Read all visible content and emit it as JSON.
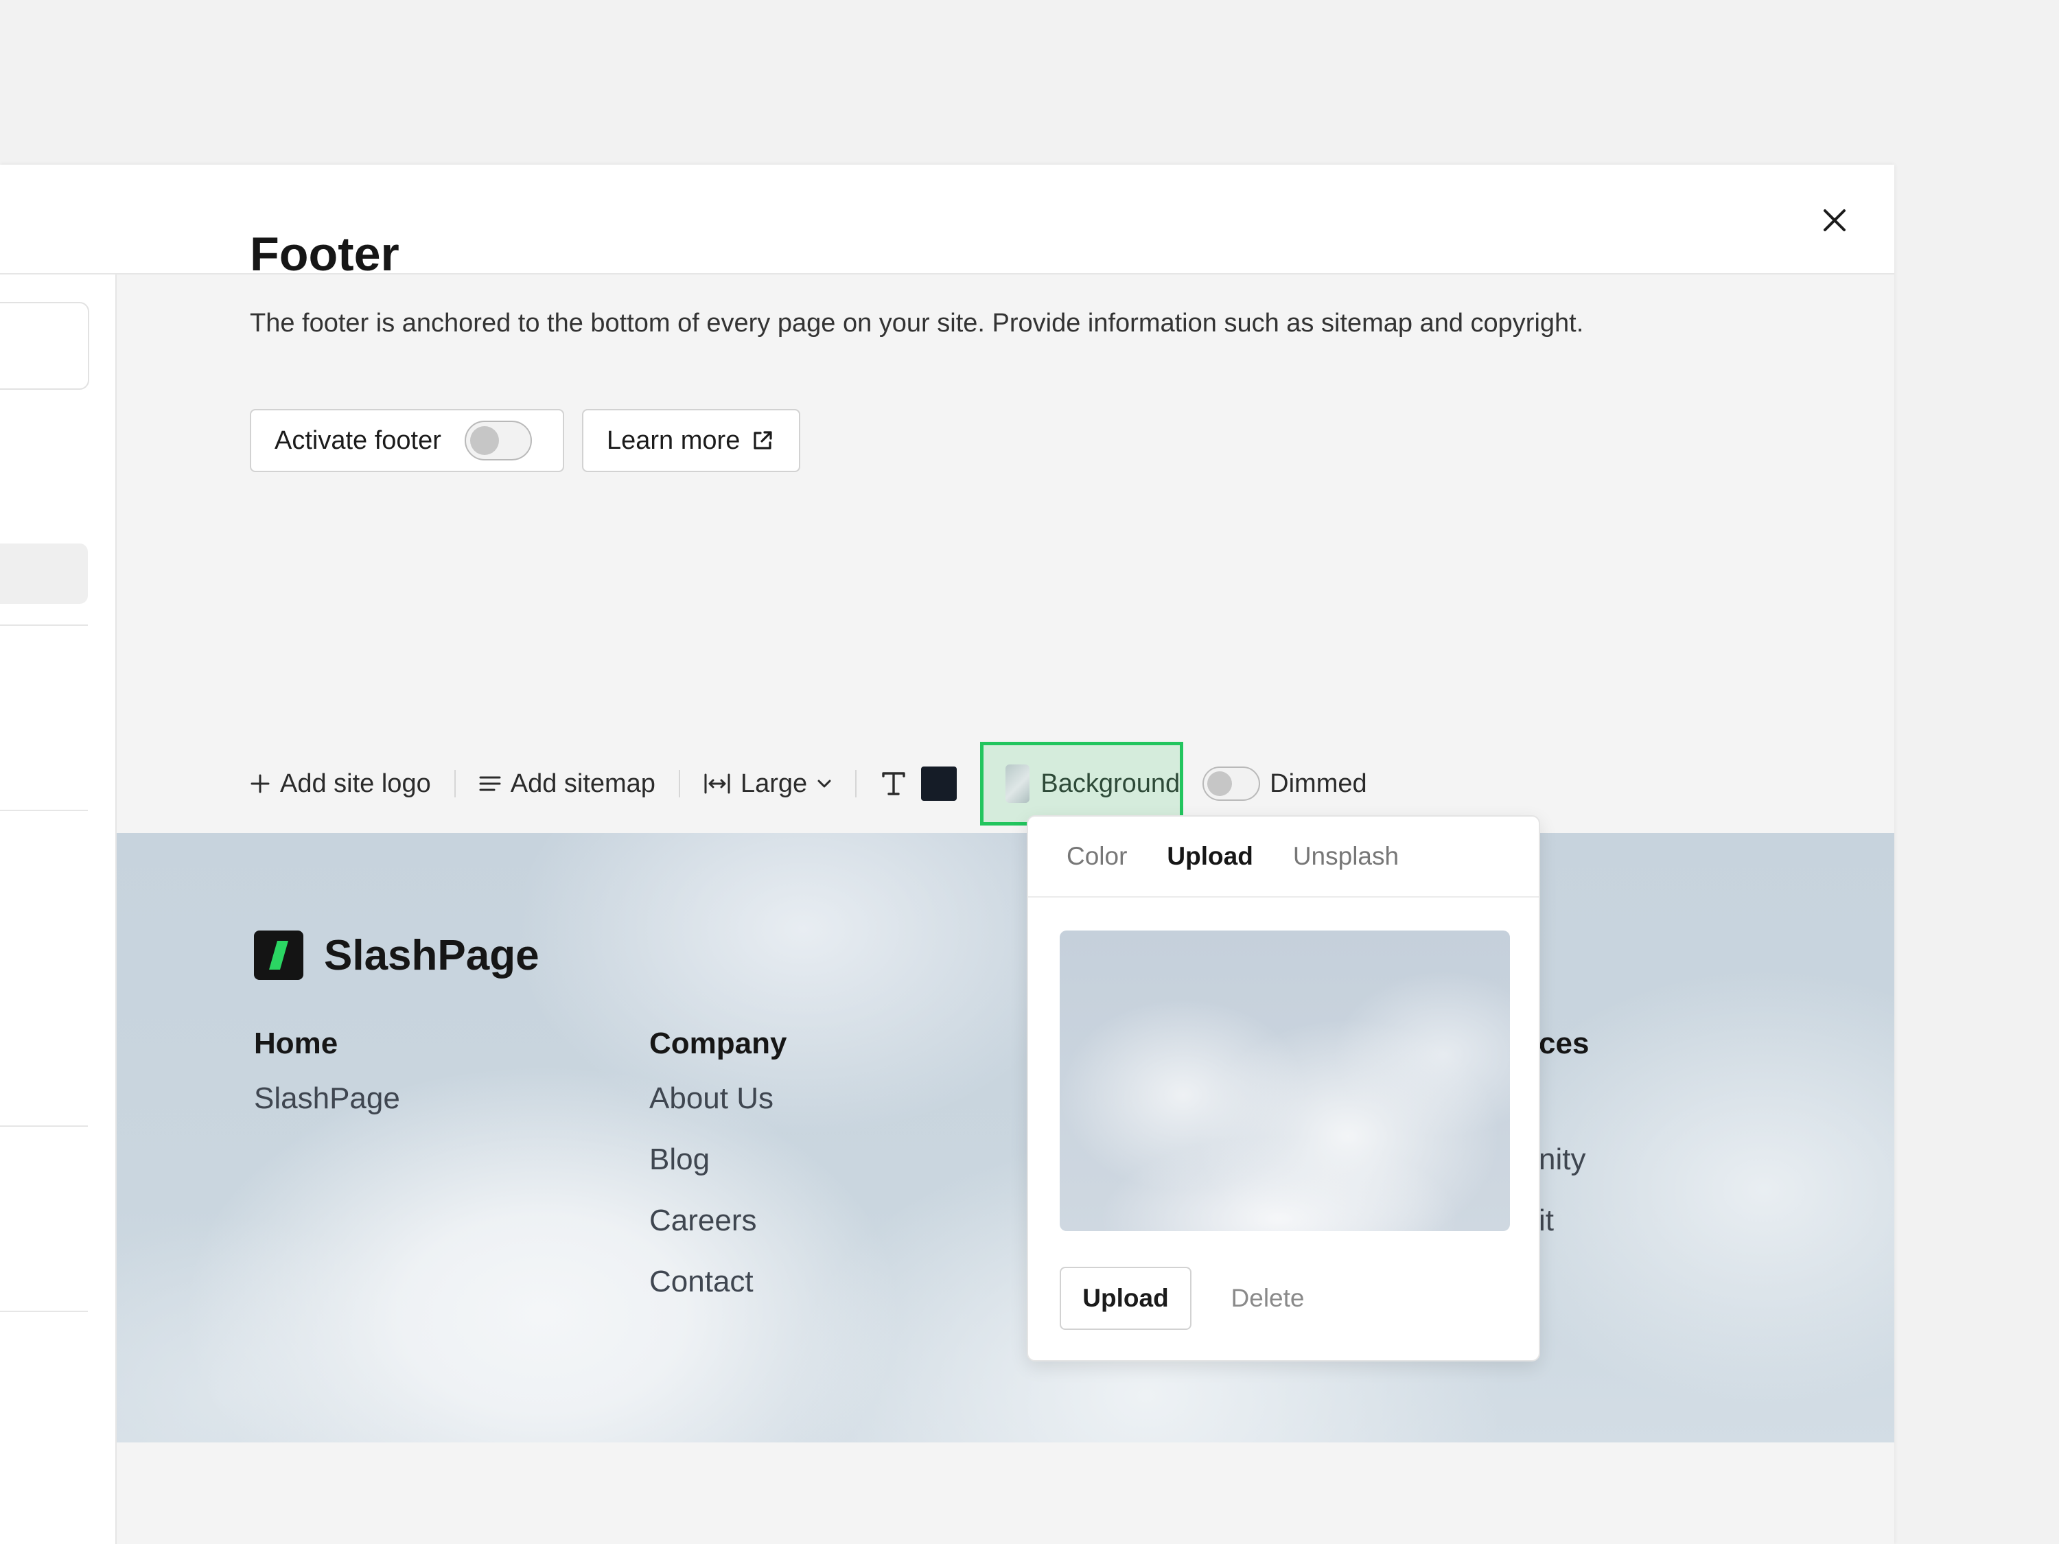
{
  "section": {
    "title": "Footer",
    "description": "The footer is anchored to the bottom of every page on your site. Provide information such as sitemap and copyright.",
    "activate_label": "Activate footer",
    "learn_more_label": "Learn more"
  },
  "toolbar": {
    "add_logo": "Add site logo",
    "add_sitemap": "Add sitemap",
    "size": "Large",
    "background": "Background",
    "dimmed": "Dimmed",
    "text_color": "#151c27"
  },
  "footer": {
    "brand": "SlashPage",
    "columns": [
      {
        "heading": "Home",
        "links": [
          "SlashPage"
        ]
      },
      {
        "heading": "Company",
        "links": [
          "About Us",
          "Blog",
          "Careers",
          "Contact"
        ]
      },
      {
        "heading": "ces",
        "links": [
          "",
          "nity",
          "it"
        ]
      }
    ]
  },
  "popover": {
    "tabs": [
      "Color",
      "Upload",
      "Unsplash"
    ],
    "active_tab": "Upload",
    "upload_label": "Upload",
    "delete_label": "Delete"
  },
  "colors": {
    "accent": "#22c55e",
    "logo_slash": "#2bd663"
  }
}
